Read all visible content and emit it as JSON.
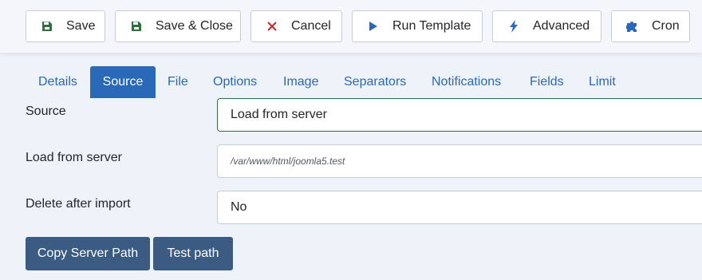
{
  "toolbar": {
    "buttons": [
      {
        "label": "Save",
        "icon": "floppy-disk-icon"
      },
      {
        "label": "Save & Close",
        "icon": "floppy-disk-icon"
      },
      {
        "label": "Cancel",
        "icon": "x-icon"
      },
      {
        "label": "Run Template",
        "icon": "play-icon"
      },
      {
        "label": "Advanced",
        "icon": "bolt-icon"
      },
      {
        "label": "Cron",
        "icon": "puzzle-icon"
      }
    ]
  },
  "tabs": {
    "items": [
      "Details",
      "Source",
      "File",
      "Options",
      "Image",
      "Separators",
      "Notifications",
      "Fields",
      "Limit"
    ],
    "active": "Source"
  },
  "form": {
    "source": {
      "label": "Source",
      "value": "Load from server"
    },
    "load_from_server": {
      "label": "Load from server",
      "placeholder": "/var/www/html/joomla5.test"
    },
    "delete_after_import": {
      "label": "Delete after import",
      "value": "No"
    }
  },
  "actions": {
    "copy_server_path": "Copy Server Path",
    "test_path": "Test path"
  },
  "colors": {
    "accent": "#2a69b8",
    "save_icon": "#2f6f3e",
    "cancel_icon": "#c52827",
    "action_button": "#3b5b83",
    "select_border": "#2f6f3e"
  }
}
